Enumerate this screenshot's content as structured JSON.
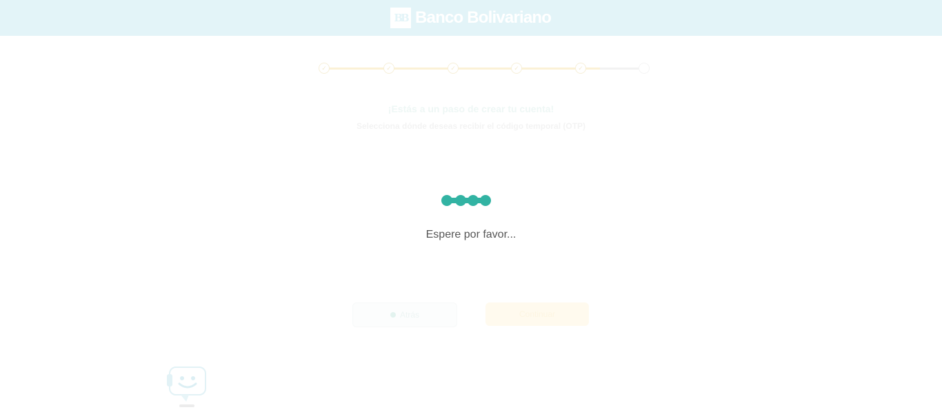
{
  "header": {
    "brand_mark": "BB",
    "brand_name": "Banco Bolivariano"
  },
  "stepper": {
    "steps": [
      "✓",
      "✓",
      "✓",
      "✓",
      "✓",
      ""
    ]
  },
  "background": {
    "title": "¡Estás a un paso de crear tu cuenta!",
    "subtitle": "Selecciona dónde deseas recibir el código temporal (OTP)",
    "back_label": "Atrás",
    "continue_label": "Continuar"
  },
  "loading": {
    "message": "Espere por favor..."
  },
  "colors": {
    "header_bg": "#e3f4f8",
    "accent_teal": "#32b3a3",
    "stepper_progress": "#fbf1d6"
  },
  "icons": {
    "brand": "bank-logo-icon",
    "spinner": "loading-spinner-icon",
    "chatbot": "chatbot-icon"
  }
}
